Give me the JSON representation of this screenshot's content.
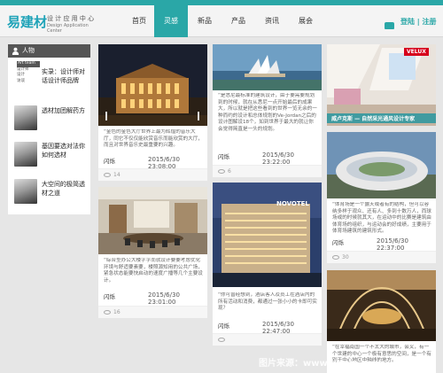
{
  "header": {
    "logo_mark": "易建材",
    "logo_cn": "设 计 应 用 中 心",
    "logo_en": "Design Application Center",
    "nav": [
      "首页",
      "灵感",
      "新品",
      "产品",
      "资讯",
      "展会"
    ],
    "active_nav": "灵感",
    "login_label": "登陆",
    "separator": "|",
    "register_label": "注册"
  },
  "sidebar": {
    "title": "人物",
    "tags": [
      "Art team",
      "设计师",
      "设计",
      "访谈"
    ],
    "items": [
      {
        "title": "实录：设计师对话设计师品牌"
      },
      {
        "title": "透材加团解药方"
      },
      {
        "title": "基因要选对法你如何选材"
      },
      {
        "title": "大空间的极简透材之道"
      }
    ]
  },
  "cards": [
    {
      "id": "c1",
      "text": "“金色的金色大厅世界上最为辉煌的音乐大厅，同它不仅仅能欣赏音乐而能欣赏的大厅，而且对世界音乐史最重要的兴趣。",
      "author": "闪烁",
      "date": "2015/6/30 23:08:00",
      "views": "14"
    },
    {
      "id": "c2",
      "text": "“综合型办公大楼字字而就设计要要考虑优化环境与舒适要素要，楼照源知用的公共广场，紧急状态能要快启动的速度广播等几个主要设计。",
      "author": "闪烁",
      "date": "2015/6/30 23:01:00",
      "views": "16"
    },
    {
      "id": "c3",
      "text": "“是悉尼最标准的建筑设计，由于要需要规划到的时候，就在从悉尼一点开始最后的成果大，所以就是把这些看到的世界一览无余的一种而约的设计和总体规划的Ve-Jordan之后的设计图解设18个，如到世界于最大的就让你会觉得简直是一头的规划。",
      "author": "闪烁",
      "date": "2015/6/30 23:22:00",
      "views": "6"
    },
    {
      "id": "c4",
      "text": "“你可曾经想到，酒店客人及员工在酒店内的所有活动和消费，都通过一张小小的卡即可实现？",
      "author": "闪烁",
      "date": "2015/6/30 22:47:00",
      "views": ""
    },
    {
      "id": "c5",
      "caption": "威卢克斯 — 自然采光通风设计专家",
      "brand": "VELUX",
      "author": "",
      "date": "",
      "views": ""
    },
    {
      "id": "c6",
      "text": "“体育场是一个露天或者有的结构，但可以容纳多样于观众、还有人、多到十数万人，而球场或的时候就其大，在运动中的比赛是建筑由体育场的组织，与运动会的好成绩，主要用于体育场建筑的建筑形式。",
      "author": "闪烁",
      "date": "2015/6/30 22:37:00",
      "views": "30"
    },
    {
      "id": "c7",
      "text": "“在幸福南国一个不太大的城市，会叉，有一个世建的中心一个极有意思的空间，是一个有别于中心地区中轴线的地方。",
      "author": "",
      "date": "",
      "views": ""
    }
  ],
  "hotel_sign": "NOVOTEL",
  "watermark": "图片来源：www.jianlo.com",
  "colors": {
    "accent": "#2aa7a7",
    "sidebar_header": "#555555",
    "background": "#e6e6e6",
    "velux_red": "#d6001c"
  }
}
